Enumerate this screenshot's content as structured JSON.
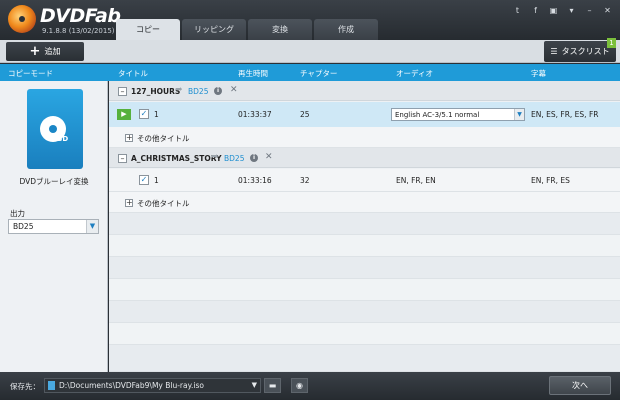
{
  "app": {
    "name": "DVDFab",
    "version": "9.1.8.8 (13/02/2015)"
  },
  "tabs": [
    "コピー",
    "リッピング",
    "変換",
    "作成"
  ],
  "window_controls": [
    "twitter-icon",
    "facebook-icon",
    "youtube-icon",
    "menu-icon",
    "minimize-icon",
    "close-icon"
  ],
  "toolbar": {
    "add_label": "追加",
    "task_label": "タスクリスト",
    "task_count": "1"
  },
  "columns": {
    "mode": "コピーモード",
    "title": "タイトル",
    "duration": "再生時間",
    "chapters": "チャプター",
    "audio": "オーディオ",
    "subtitle": "字幕"
  },
  "left": {
    "mode_name": "DVDブルーレイ変換",
    "output_label": "出力",
    "output_value": "BD25",
    "icon_text": "BD"
  },
  "groups": [
    {
      "name": "127_HOURS",
      "target": "BD25",
      "title": {
        "num": "1",
        "duration": "01:33:37",
        "chapters": "25",
        "audio": "English AC-3/5.1 normal",
        "subtitle": "EN, ES, FR, ES, FR"
      },
      "other_titles": "その他タイトル"
    },
    {
      "name": "A_CHRISTMAS_STORY",
      "target": "BD25",
      "title": {
        "num": "1",
        "duration": "01:33:16",
        "chapters": "32",
        "audio": "EN, FR, EN",
        "subtitle": "EN, FR, ES"
      },
      "other_titles": "その他タイトル"
    }
  ],
  "bottom": {
    "save_label": "保存先：",
    "path": "D:\\Documents\\DVDFab9\\My Blu-ray.iso",
    "next_label": "次へ"
  },
  "colors": {
    "accent": "#1f9bd8",
    "play": "#56b13c",
    "selected_row": "#cfe8f6"
  }
}
